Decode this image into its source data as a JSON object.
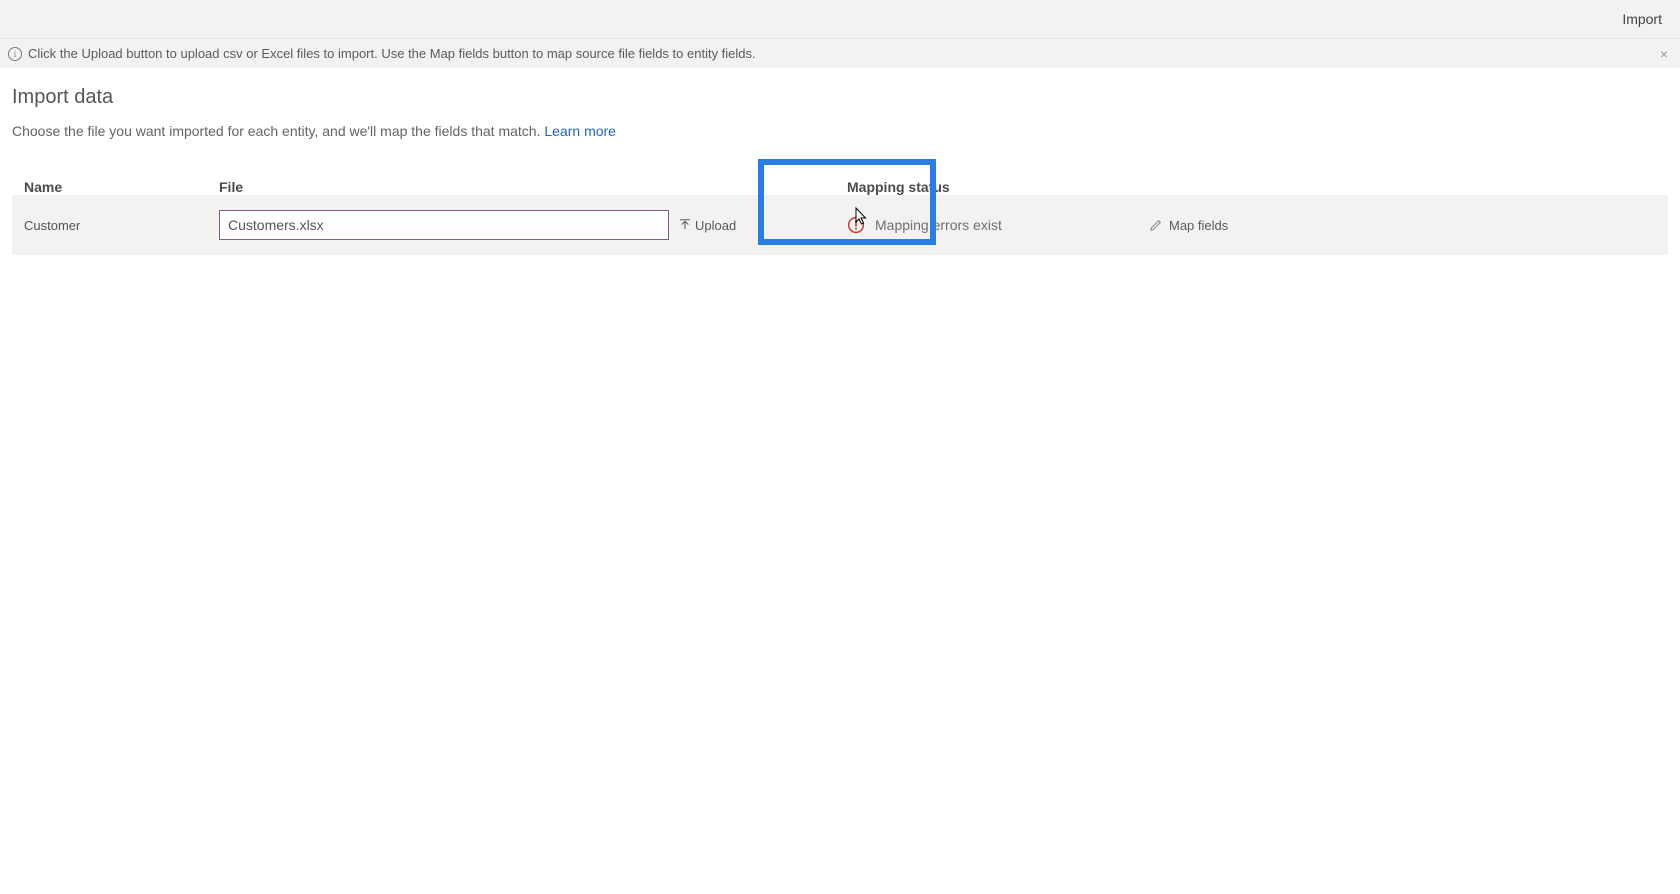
{
  "commandBar": {
    "import": "Import"
  },
  "banner": {
    "text": "Click the Upload button to upload csv or Excel files to import. Use the Map fields button to map source file fields to entity fields.",
    "close": "×"
  },
  "page": {
    "title": "Import data",
    "lead": "Choose the file you want imported for each entity, and we'll map the fields that match. ",
    "learnMore": "Learn more"
  },
  "columns": {
    "name": "Name",
    "file": "File",
    "status": "Mapping status"
  },
  "row": {
    "entity": "Customer",
    "fileValue": "Customers.xlsx",
    "upload": "Upload",
    "statusText": "Mapping errors exist",
    "mapFields": "Map fields"
  }
}
